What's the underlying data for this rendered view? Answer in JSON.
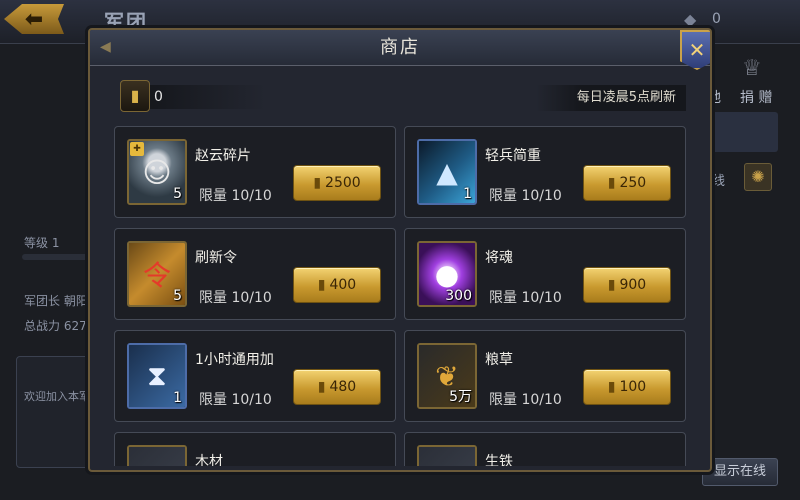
{
  "background": {
    "title": "军团",
    "gem_count": "0",
    "level_label": "等级 1",
    "leader_label": "军团长 朝阳",
    "power_label": "总战力 627",
    "welcome_text": "欢迎加入本军",
    "right_label_1": "地",
    "right_label_2": "捐 赠",
    "line_label": "线",
    "show_online": "显示在线"
  },
  "dialog": {
    "title": "商店",
    "currency_value": "0",
    "refresh_note": "每日凌晨5点刷新"
  },
  "items": [
    {
      "name": "赵云碎片",
      "qty": "5",
      "limit": "限量 10/10",
      "price": "2500",
      "icon": "hero-portrait-icon"
    },
    {
      "name": "轻兵简重",
      "qty": "1",
      "limit": "限量 10/10",
      "price": "250",
      "icon": "boot-icon"
    },
    {
      "name": "刷新令",
      "qty": "5",
      "limit": "限量 10/10",
      "price": "400",
      "icon": "refresh-token-icon"
    },
    {
      "name": "将魂",
      "qty": "300",
      "limit": "限量 10/10",
      "price": "900",
      "icon": "soul-orb-icon"
    },
    {
      "name": "1小时通用加",
      "qty": "1",
      "limit": "限量 10/10",
      "price": "480",
      "icon": "speedup-hourglass-icon"
    },
    {
      "name": "粮草",
      "qty": "5万",
      "limit": "限量 10/10",
      "price": "100",
      "icon": "grain-icon"
    },
    {
      "name": "木材",
      "icon": "wood-icon"
    },
    {
      "name": "生铁",
      "icon": "iron-icon"
    }
  ],
  "colors": {
    "gold_button": "#c99a2f",
    "card_bg": "#1c1e24",
    "dialog_bg": "#232630",
    "frame_gold": "#6b5a3a"
  }
}
